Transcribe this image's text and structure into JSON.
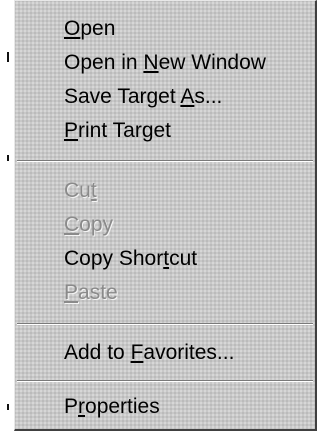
{
  "context_menu": {
    "items": [
      {
        "label": "Open",
        "mnemonic_index": 0,
        "enabled": true
      },
      {
        "label": "Open in New Window",
        "mnemonic_index": 8,
        "enabled": true
      },
      {
        "label": "Save Target As...",
        "mnemonic_index": 12,
        "enabled": true
      },
      {
        "label": "Print Target",
        "mnemonic_index": 0,
        "enabled": true
      },
      {
        "label": "Cut",
        "mnemonic_index": 2,
        "enabled": false
      },
      {
        "label": "Copy",
        "mnemonic_index": 0,
        "enabled": false
      },
      {
        "label": "Copy Shortcut",
        "mnemonic_index": 9,
        "enabled": true
      },
      {
        "label": "Paste",
        "mnemonic_index": 0,
        "enabled": false
      },
      {
        "label": "Add to Favorites...",
        "mnemonic_index": 7,
        "enabled": true
      },
      {
        "label": "Properties",
        "mnemonic_index": 1,
        "enabled": true
      }
    ]
  }
}
